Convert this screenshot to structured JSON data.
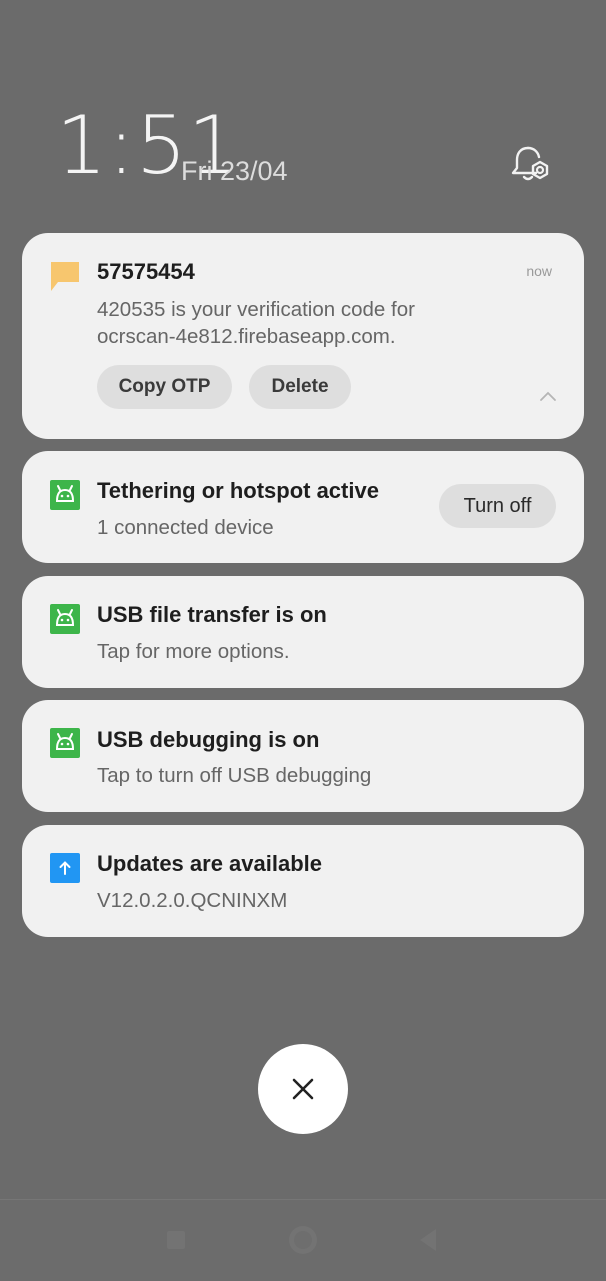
{
  "lockscreen": {
    "time": "1:51",
    "date": "Fri 23/04"
  },
  "notifications": [
    {
      "icon": "message-icon",
      "title": "57575454",
      "time": "now",
      "body_line1": "420535 is your verification code for",
      "body_line2": "ocrscan-4e812.firebaseapp.com.",
      "actions": [
        "Copy OTP",
        "Delete"
      ]
    },
    {
      "icon": "android-icon",
      "title": "Tethering or hotspot active",
      "body": "1 connected device",
      "action": "Turn off"
    },
    {
      "icon": "android-icon",
      "title": "USB file transfer is on",
      "body": "Tap for more options."
    },
    {
      "icon": "android-icon",
      "title": "USB debugging is on",
      "body": "Tap to turn off USB debugging"
    },
    {
      "icon": "update-icon",
      "title": "Updates are available",
      "body": "V12.0.2.0.QCNINXM"
    }
  ],
  "colors": {
    "background": "#6b6b6b",
    "card": "#f1f1f1",
    "message_icon": "#f7c66e",
    "android_icon": "#3db54a",
    "update_icon": "#2196f3"
  },
  "navbar": {
    "buttons": [
      "recents-icon",
      "home-icon",
      "back-icon"
    ]
  }
}
